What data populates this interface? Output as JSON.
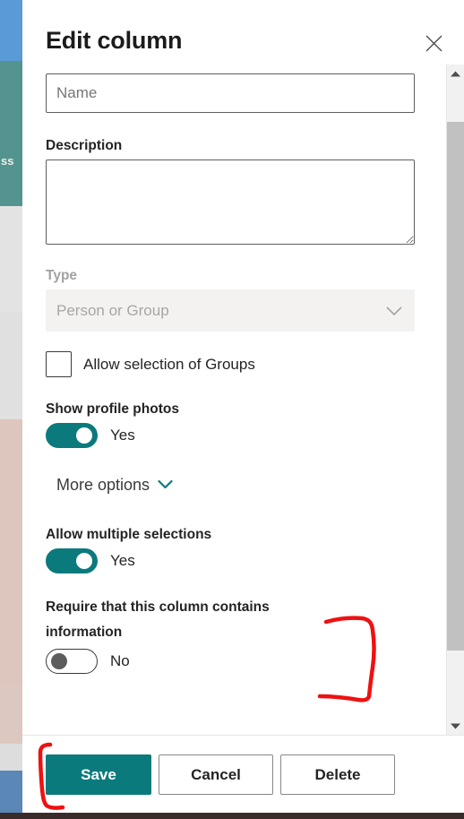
{
  "background_page": {
    "visible_label": "ss",
    "band_colors": [
      "#5b9bd5",
      "#549490",
      "#e3e3e3",
      "#e0e0e0",
      "#ddc6bd",
      "#dcc8c0",
      "#dddddd",
      "#5a87b5",
      "#3a2b2b"
    ]
  },
  "panel": {
    "title": "Edit column",
    "close_icon": "close-icon"
  },
  "fields": {
    "name": {
      "value": "",
      "placeholder": "Name"
    },
    "description": {
      "label": "Description",
      "value": "",
      "placeholder": ""
    },
    "type": {
      "label": "Type",
      "selected": "Person or Group",
      "disabled": true,
      "chevron_icon": "chevron-down-icon"
    },
    "allow_groups": {
      "label": "Allow selection of Groups",
      "checked": false
    },
    "show_profile_photos": {
      "label": "Show profile photos",
      "state": "Yes",
      "on": true
    },
    "more_options": {
      "label": "More options",
      "chevron_icon": "chevron-down-icon"
    },
    "allow_multiple_selections": {
      "label": "Allow multiple selections",
      "state": "Yes",
      "on": true
    },
    "require_information": {
      "label": "Require that this column contains information",
      "state": "No",
      "on": false
    }
  },
  "footer": {
    "save_label": "Save",
    "cancel_label": "Cancel",
    "delete_label": "Delete"
  },
  "scrollbar": {
    "up_arrow_icon": "triangle-up-icon",
    "down_arrow_icon": "triangle-down-icon"
  },
  "colors": {
    "accent_teal": "#0b7a7d",
    "annotation_red": "#ee1111",
    "text_primary": "#242424",
    "text_disabled": "#a6a6a6",
    "border": "#605e5c"
  },
  "annotations": {
    "bracket_require_field": "hand-drawn red bracket around the Require-that-this-column-contains-information toggle",
    "bracket_save_button": "hand-drawn red bracket to the left of the Save button"
  }
}
